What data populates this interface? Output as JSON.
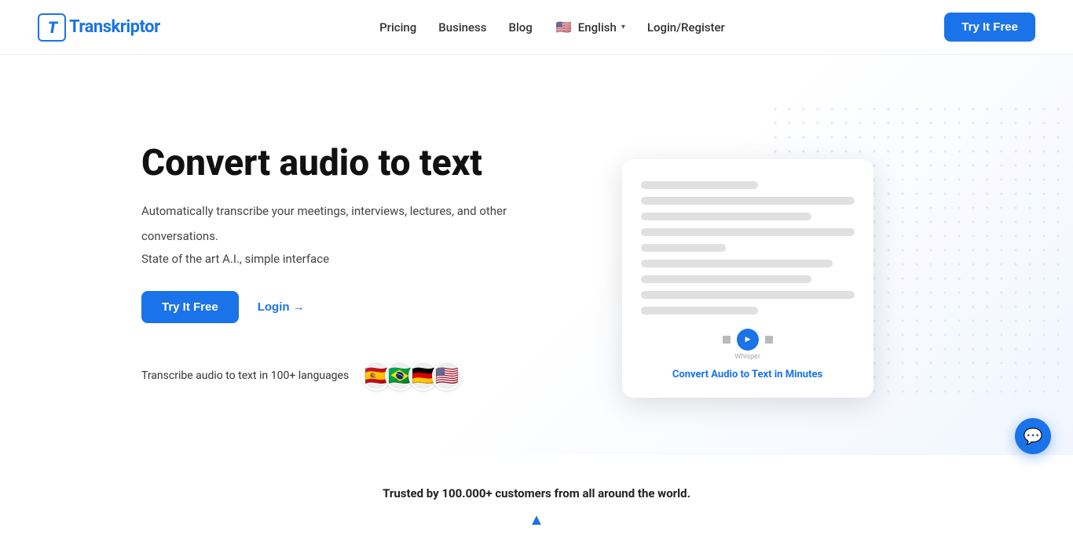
{
  "brand": {
    "logo_letter": "T",
    "name_prefix": "ranskriptor"
  },
  "navbar": {
    "links": [
      {
        "id": "pricing",
        "label": "Pricing",
        "href": "#"
      },
      {
        "id": "business",
        "label": "Business",
        "href": "#"
      },
      {
        "id": "blog",
        "label": "Blog",
        "href": "#"
      }
    ],
    "language": {
      "flag_emoji": "🇺🇸",
      "label": "English",
      "chevron": "▾"
    },
    "login_register": "Login/Register",
    "try_it_free": "Try It Free"
  },
  "hero": {
    "title": "Convert audio to text",
    "subtitle1": "Automatically transcribe your meetings, interviews, lectures, and other",
    "subtitle2": "conversations.",
    "subtitle3": "State of the art A.I., simple interface",
    "btn_try": "Try It Free",
    "btn_login": "Login →",
    "languages_label": "Transcribe audio to text in 100+ languages",
    "flags": [
      "🇪🇸",
      "🇧🇷",
      "🇩🇪",
      "🇺🇸"
    ],
    "convert_label": "Convert Audio to Text in Minutes"
  },
  "trusted": {
    "text": "Trusted by 100.000+ customers from all around the world."
  },
  "chat": {
    "icon": "💬"
  }
}
